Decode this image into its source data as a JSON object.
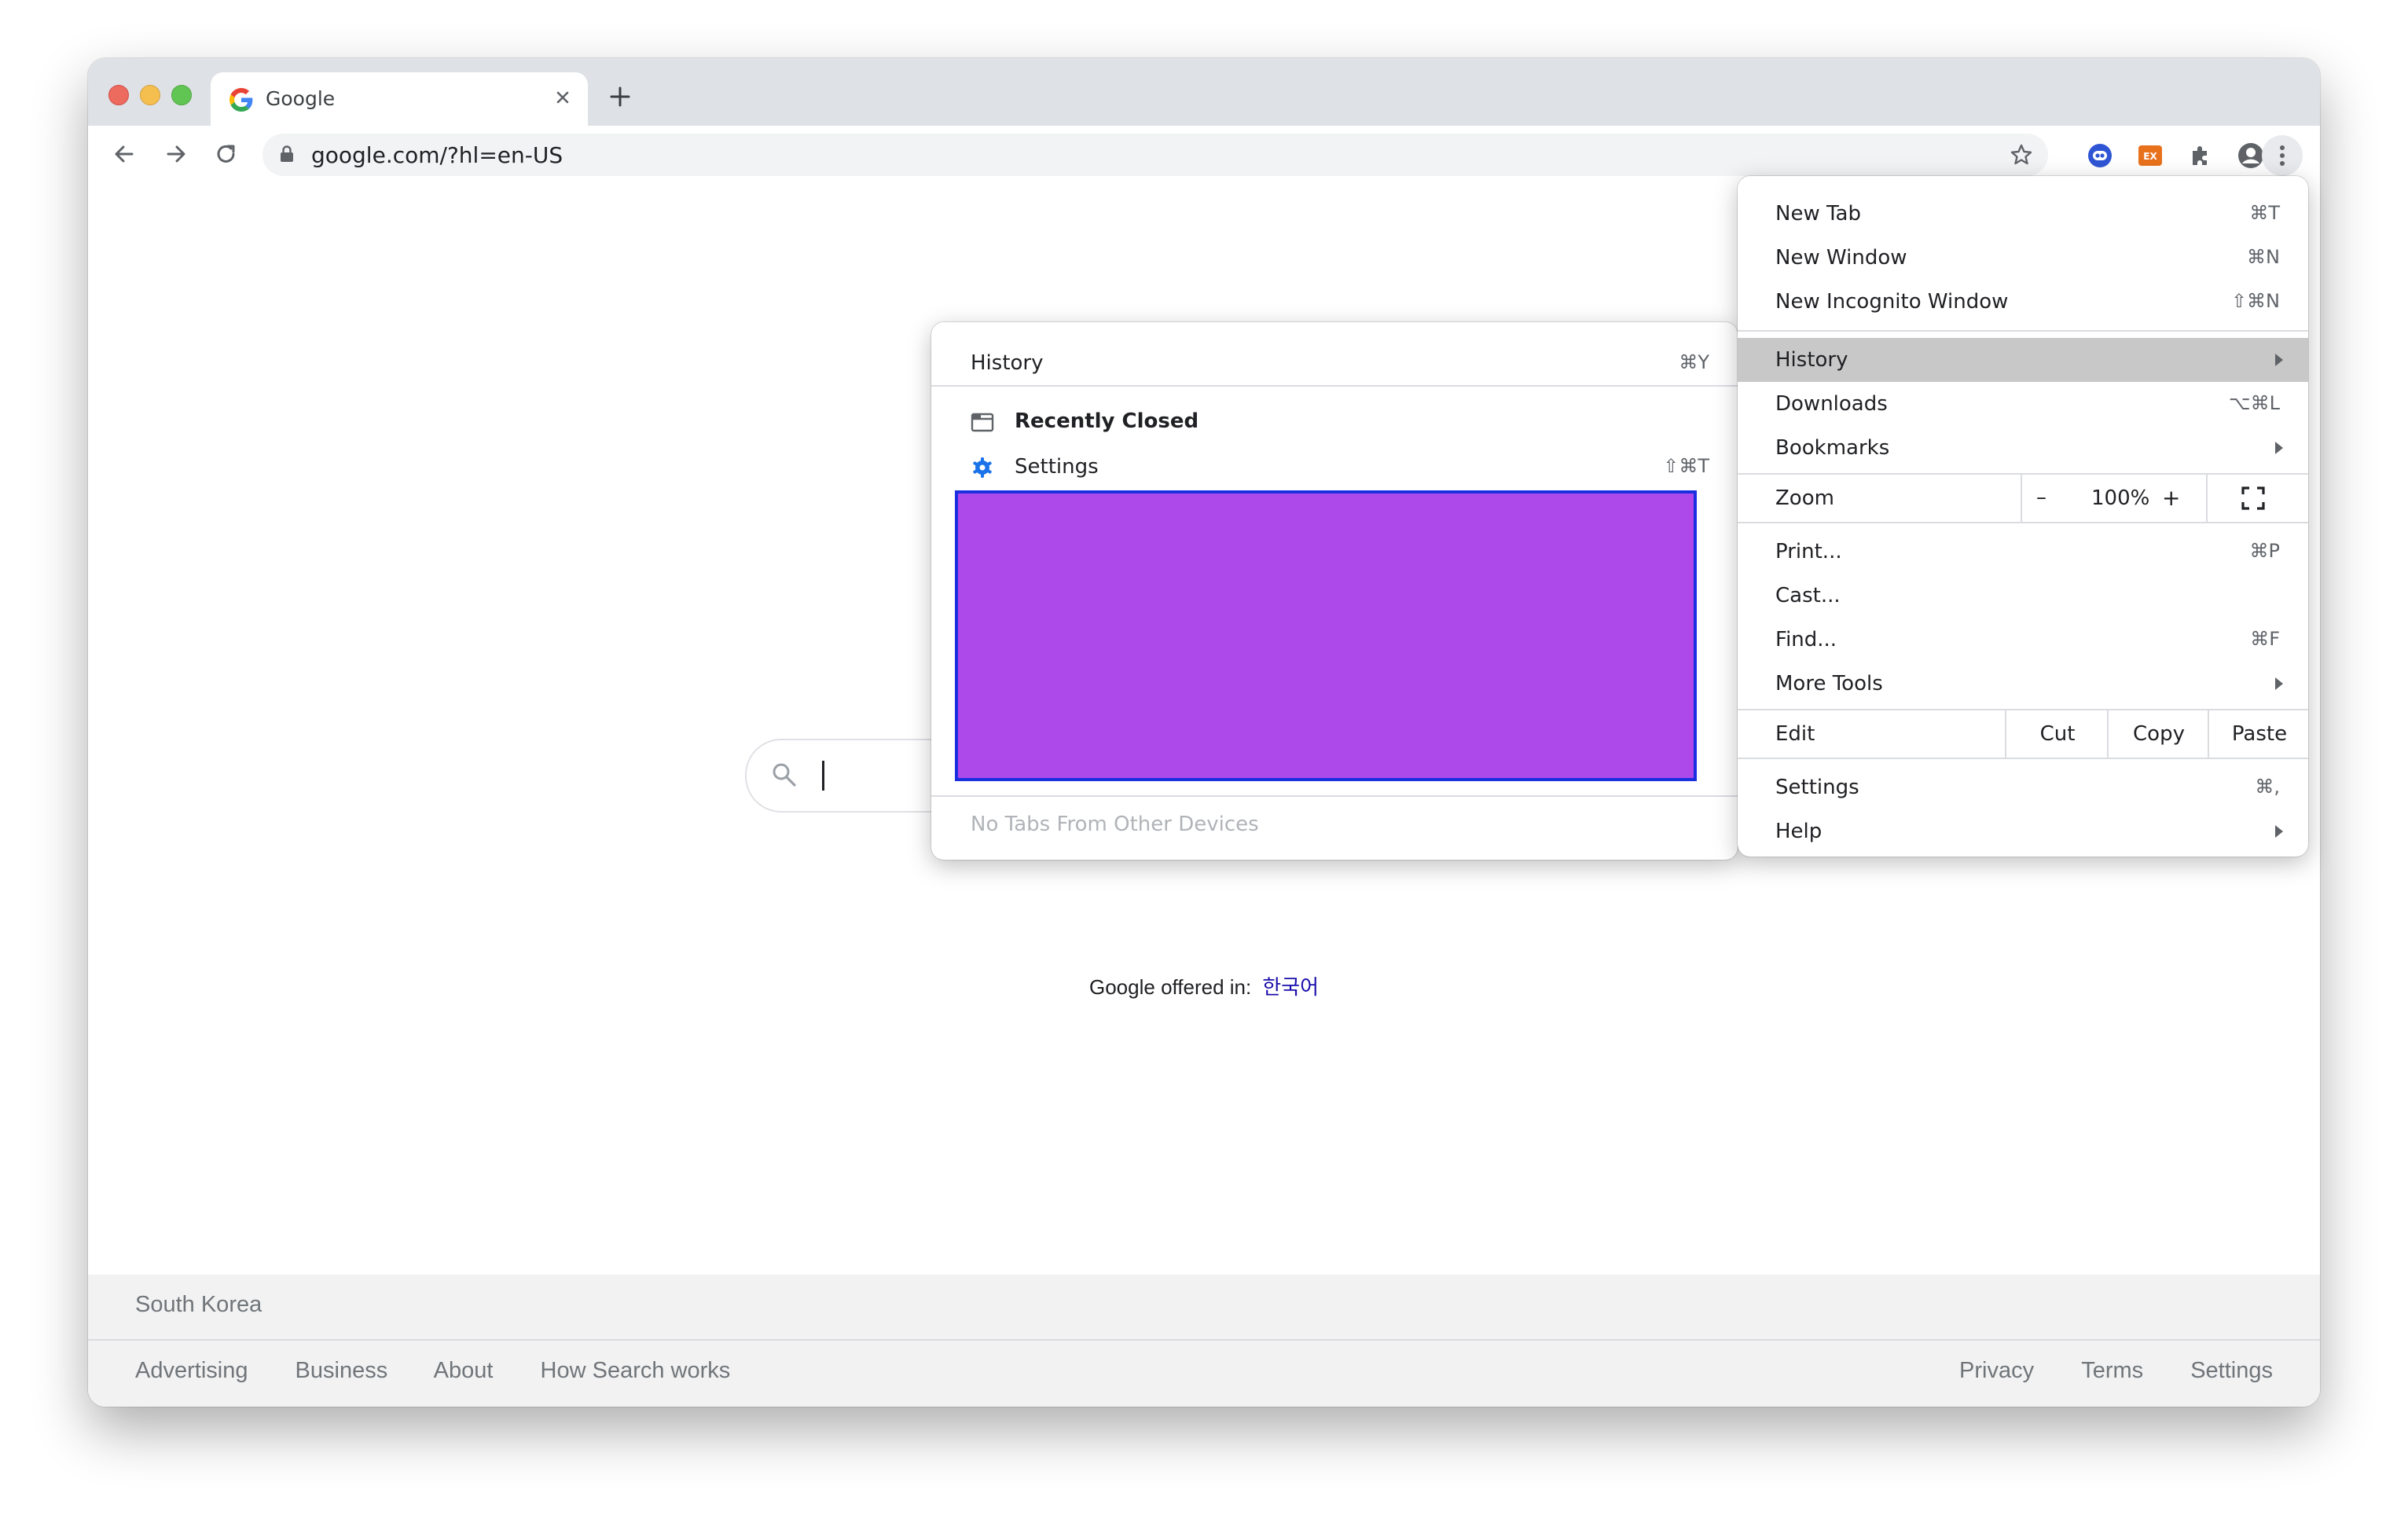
{
  "tab": {
    "title": "Google"
  },
  "omnibox": {
    "url": "google.com/?hl=en-US"
  },
  "page": {
    "offered_text": "Google offered in:",
    "offered_lang": "한국어",
    "country": "South Korea",
    "footer_left": [
      "Advertising",
      "Business",
      "About",
      "How Search works"
    ],
    "footer_right": [
      "Privacy",
      "Terms",
      "Settings"
    ]
  },
  "main_menu": {
    "new_tab": {
      "label": "New Tab",
      "shortcut": "⌘T"
    },
    "new_window": {
      "label": "New Window",
      "shortcut": "⌘N"
    },
    "new_incognito": {
      "label": "New Incognito Window",
      "shortcut": "⇧⌘N"
    },
    "history": {
      "label": "History"
    },
    "downloads": {
      "label": "Downloads",
      "shortcut": "⌥⌘L"
    },
    "bookmarks": {
      "label": "Bookmarks"
    },
    "zoom": {
      "label": "Zoom",
      "minus": "–",
      "value": "100%",
      "plus": "+"
    },
    "print": {
      "label": "Print...",
      "shortcut": "⌘P"
    },
    "cast": {
      "label": "Cast..."
    },
    "find": {
      "label": "Find...",
      "shortcut": "⌘F"
    },
    "more_tools": {
      "label": "More Tools"
    },
    "edit": {
      "label": "Edit",
      "cut": "Cut",
      "copy": "Copy",
      "paste": "Paste"
    },
    "settings": {
      "label": "Settings",
      "shortcut": "⌘,"
    },
    "help": {
      "label": "Help"
    }
  },
  "history_menu": {
    "history": {
      "label": "History",
      "shortcut": "⌘Y"
    },
    "recently_closed": {
      "label": "Recently Closed"
    },
    "settings": {
      "label": "Settings",
      "shortcut": "⇧⌘T"
    },
    "no_tabs": "No Tabs From Other Devices"
  },
  "colors": {
    "accent_blue": "#1a73e8",
    "highlight_purple": "#ad48eb",
    "highlight_border": "#1a2fe0",
    "menu_active_bg": "#c8c8c8"
  }
}
